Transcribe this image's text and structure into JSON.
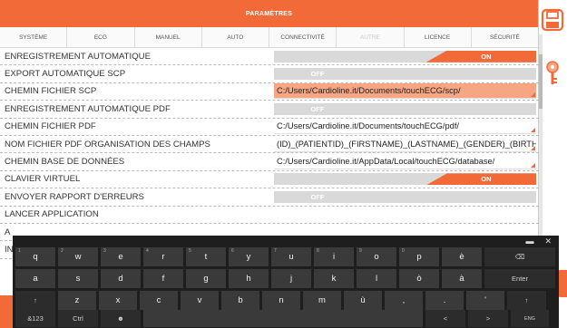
{
  "header": {
    "title": "PARAMÈTRES"
  },
  "tabs": [
    {
      "label": "SYSTÈME",
      "disabled": false
    },
    {
      "label": "ECG",
      "disabled": false
    },
    {
      "label": "MANUEL",
      "disabled": false
    },
    {
      "label": "AUTO",
      "disabled": false
    },
    {
      "label": "CONNECTIVITÉ",
      "disabled": false
    },
    {
      "label": "AUTRE",
      "disabled": true
    },
    {
      "label": "LICENCE",
      "disabled": false
    },
    {
      "label": "SÉCURITÉ",
      "disabled": false
    }
  ],
  "settings": [
    {
      "label": "ENREGISTREMENT AUTOMATIQUE",
      "type": "toggle",
      "value": "ON"
    },
    {
      "label": "EXPORT AUTOMATIQUE SCP",
      "type": "toggle",
      "value": "OFF"
    },
    {
      "label": "CHEMIN FICHIER SCP",
      "type": "path",
      "value": "C:/Users/Cardioline.it/Documents/touchECG/scp/",
      "highlighted": true
    },
    {
      "label": "ENREGISTREMENT AUTOMATIQUE PDF",
      "type": "toggle",
      "value": "OFF"
    },
    {
      "label": "CHEMIN FICHIER PDF",
      "type": "path",
      "value": "C:/Users/Cardioline.it/Documents/touchECG/pdf/",
      "highlighted": false
    },
    {
      "label": "NOM FICHIER PDF ORGANISATION DES CHAMPS",
      "type": "path",
      "value": "(ID)_(PATIENTID)_(FIRSTNAME)_(LASTNAME)_(GENDER)_(BIRTH",
      "highlighted": false
    },
    {
      "label": "CHEMIN BASE DE DONNÉES",
      "type": "path",
      "value": "C:/Users/Cardioline.it/AppData/Local/touchECG/database/",
      "highlighted": false
    },
    {
      "label": "CLAVIER VIRTUEL",
      "type": "toggle",
      "value": "ON"
    },
    {
      "label": "ENVOYER RAPPORT D'ERREURS",
      "type": "toggle",
      "value": "OFF"
    },
    {
      "label": "LANCER APPLICATION",
      "type": "none",
      "value": ""
    },
    {
      "label": "A",
      "type": "none",
      "value": ""
    },
    {
      "label": "IN",
      "type": "none",
      "value": ""
    }
  ],
  "icons": {
    "save": "save-icon",
    "key": "key-icon"
  },
  "colors": {
    "accent": "#f26a38",
    "toggle_off": "#d9d9d9",
    "highlight": "#f7a683",
    "keyboard_bg": "#1e1e1e",
    "key_bg": "#3a3a3a"
  },
  "keyboard": {
    "top_controls": [
      "▬",
      "✕"
    ],
    "row1": [
      {
        "label": "q",
        "alt": "1"
      },
      {
        "label": "w",
        "alt": "2"
      },
      {
        "label": "e",
        "alt": "3"
      },
      {
        "label": "r",
        "alt": "4"
      },
      {
        "label": "t",
        "alt": "5"
      },
      {
        "label": "y",
        "alt": "6"
      },
      {
        "label": "u",
        "alt": "7"
      },
      {
        "label": "i",
        "alt": "8"
      },
      {
        "label": "o",
        "alt": "9"
      },
      {
        "label": "p",
        "alt": "0"
      },
      {
        "label": "è",
        "alt": ""
      },
      {
        "label": "⌫",
        "alt": ""
      }
    ],
    "row2": [
      {
        "label": "a",
        "alt": ""
      },
      {
        "label": "s",
        "alt": ""
      },
      {
        "label": "d",
        "alt": ""
      },
      {
        "label": "f",
        "alt": ""
      },
      {
        "label": "g",
        "alt": ""
      },
      {
        "label": "h",
        "alt": ""
      },
      {
        "label": "j",
        "alt": ""
      },
      {
        "label": "k",
        "alt": ""
      },
      {
        "label": "l",
        "alt": ""
      },
      {
        "label": "ò",
        "alt": ""
      },
      {
        "label": "à",
        "alt": ""
      },
      {
        "label": "Enter",
        "alt": ""
      }
    ],
    "row3": [
      {
        "label": "↑",
        "alt": ""
      },
      {
        "label": "z",
        "alt": ""
      },
      {
        "label": "x",
        "alt": ""
      },
      {
        "label": "c",
        "alt": ""
      },
      {
        "label": "v",
        "alt": ""
      },
      {
        "label": "b",
        "alt": ""
      },
      {
        "label": "n",
        "alt": ""
      },
      {
        "label": "m",
        "alt": ""
      },
      {
        "label": "ù",
        "alt": ""
      },
      {
        "label": ",",
        "alt": ""
      },
      {
        "label": ".",
        "alt": ""
      },
      {
        "label": "'",
        "alt": ""
      },
      {
        "label": "↑",
        "alt": ""
      }
    ],
    "row4": [
      {
        "label": "&123"
      },
      {
        "label": "Ctrl"
      },
      {
        "label": "☻"
      },
      {
        "label": ""
      },
      {
        "label": "<"
      },
      {
        "label": ">"
      },
      {
        "label": "ENG"
      }
    ]
  }
}
